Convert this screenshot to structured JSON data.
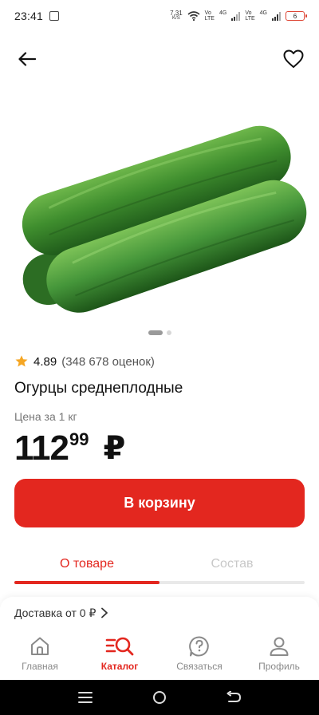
{
  "status_bar": {
    "time": "23:41",
    "net_speed_value": "7,31",
    "net_speed_unit": "K/S",
    "sim1_top": "Vo",
    "sim1_bottom": "LTE",
    "sim1_net": "4G",
    "sim2_top": "Vo",
    "sim2_bottom": "LTE",
    "sim2_net": "4G",
    "battery": "6",
    "battery_color": "#dd4433"
  },
  "header": {
    "back_icon": "arrow-left-icon",
    "favorite_icon": "heart-outline-icon"
  },
  "gallery": {
    "image_icon": "cucumber-image",
    "page_count": 2,
    "active_page": 1
  },
  "product": {
    "rating": "4.89",
    "rating_count": "(348 678 оценок)",
    "title": "Огурцы среднеплодные",
    "price_label": "Цена за 1 кг",
    "price_main": "112",
    "price_cents": "99",
    "currency": "₽"
  },
  "actions": {
    "cart_button": "В корзину",
    "accent_color": "#e3271f"
  },
  "tabs": [
    {
      "label": "О товаре",
      "active": true
    },
    {
      "label": "Состав",
      "active": false
    }
  ],
  "delivery": {
    "text": "Доставка от 0 ₽"
  },
  "bottom_nav": [
    {
      "label": "Главная",
      "icon": "home-icon",
      "active": false
    },
    {
      "label": "Каталог",
      "icon": "catalog-search-icon",
      "active": true
    },
    {
      "label": "Связаться",
      "icon": "question-icon",
      "active": false
    },
    {
      "label": "Профиль",
      "icon": "profile-icon",
      "active": false
    }
  ]
}
